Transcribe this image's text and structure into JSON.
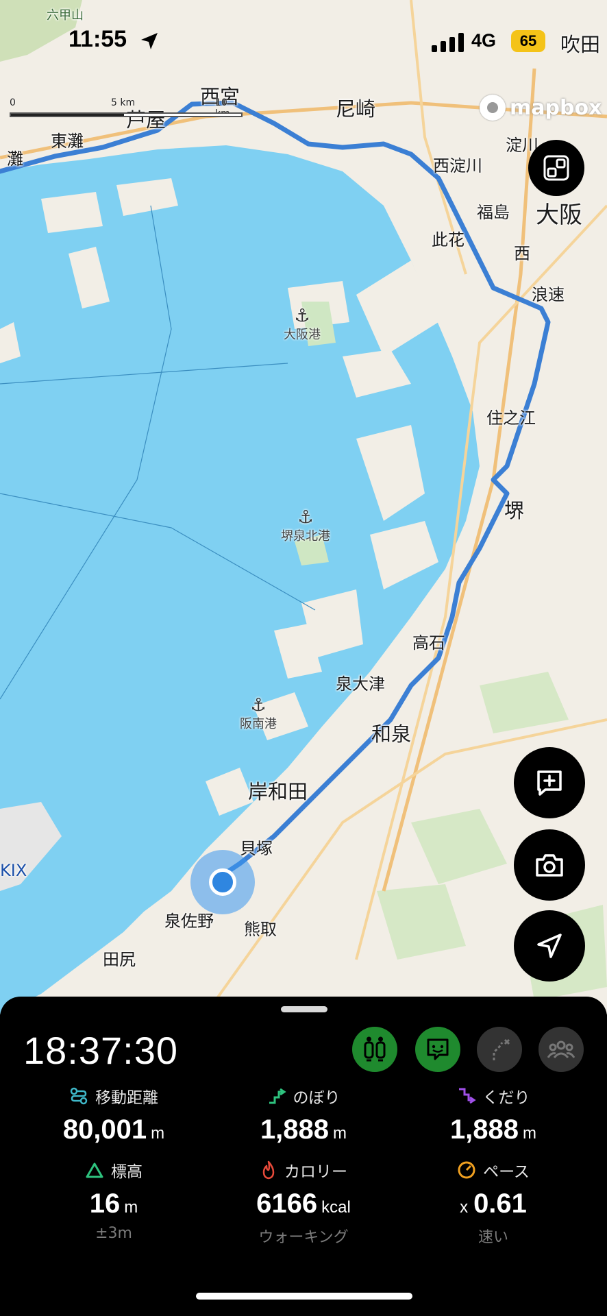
{
  "status_bar": {
    "time": "11:55",
    "network": "4G",
    "battery": "65"
  },
  "map": {
    "scale": {
      "zero": "0",
      "mid": "5 km",
      "max": "10 km"
    },
    "attribution": "mapbox",
    "places": {
      "rokkosan": "六甲山",
      "nada": "灘",
      "higashinada": "東灘",
      "ashiya": "芦屋",
      "nishinomiya": "西宮",
      "amagasaki": "尼崎",
      "suita": "吹田",
      "yodogawa": "淀川",
      "nishiyodogawa": "西淀川",
      "fukushima": "福島",
      "osaka": "大阪",
      "konohana": "此花",
      "nishi": "西",
      "naniwa": "浪速",
      "suminoe": "住之江",
      "sakai": "堺",
      "takaishi": "高石",
      "izumiotsu": "泉大津",
      "izumi": "和泉",
      "kishiwada": "岸和田",
      "kaizuka": "貝塚",
      "izumisano": "泉佐野",
      "kumatori": "熊取",
      "tajiri": "田尻",
      "kix": "KIX"
    },
    "ports": {
      "osaka_port": "大阪港",
      "sakai_senboku_port": "堺泉北港",
      "hannan_port": "阪南港"
    },
    "colors": {
      "route": "#3b7fd4",
      "water": "#7fd0f2",
      "land": "#f2eee6"
    }
  },
  "buttons": {
    "fit_icon": "fit-bounds-icon",
    "note_icon": "add-note-icon",
    "camera_icon": "camera-icon",
    "locate_icon": "navigation-arrow-icon"
  },
  "panel": {
    "elapsed_time": "18:37:30",
    "mode_icons": [
      "walking-party-icon",
      "chat-bubble-icon",
      "off-route-icon",
      "group-icon"
    ],
    "stats": {
      "distance": {
        "label": "移動距離",
        "value": "80,001",
        "unit": "m"
      },
      "ascent": {
        "label": "のぼり",
        "value": "1,888",
        "unit": "m"
      },
      "descent": {
        "label": "くだり",
        "value": "1,888",
        "unit": "m"
      },
      "elevation": {
        "label": "標高",
        "value": "16",
        "unit": "m",
        "sub": "±3m"
      },
      "calories": {
        "label": "カロリー",
        "value": "6166",
        "unit": "kcal",
        "sub": "ウォーキング"
      },
      "pace": {
        "label": "ペース",
        "prefix": "x",
        "value": "0.61",
        "sub": "速い"
      }
    },
    "colors": {
      "accent_green": "#1f8a2e",
      "distance_icon": "#3fb8c9",
      "ascent_icon": "#2ec27e",
      "descent_icon": "#a050e8",
      "elevation_icon": "#2ec27e",
      "calorie_icon": "#e84a3a",
      "pace_icon": "#f0a020"
    }
  }
}
